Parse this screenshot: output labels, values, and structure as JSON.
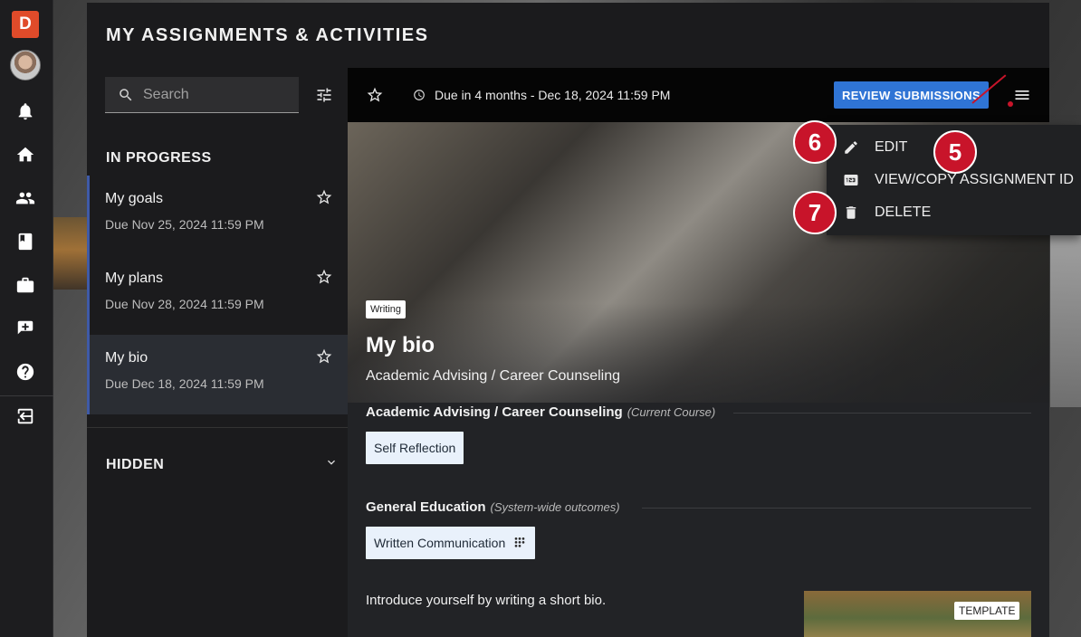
{
  "app": {
    "logo_letter": "D"
  },
  "panel": {
    "title": "MY ASSIGNMENTS & ACTIVITIES"
  },
  "search": {
    "placeholder": "Search"
  },
  "sections": {
    "in_progress": "IN PROGRESS",
    "hidden": "HIDDEN"
  },
  "assignments": [
    {
      "name": "My goals",
      "due": "Due Nov 25, 2024 11:59 PM"
    },
    {
      "name": "My plans",
      "due": "Due Nov 28, 2024 11:59 PM"
    },
    {
      "name": "My bio",
      "due": "Due Dec 18, 2024 11:59 PM",
      "active": true
    }
  ],
  "detail": {
    "due_text": "Due in 4 months - Dec 18, 2024 11:59 PM",
    "review_button": "REVIEW SUBMISSIONS",
    "tag": "Writing",
    "title": "My bio",
    "subtitle": "Academic Advising / Career Counseling",
    "groups": [
      {
        "heading": "Academic Advising / Career Counseling",
        "note": "(Current Course)",
        "chip": "Self Reflection"
      },
      {
        "heading": "General Education",
        "note": "(System-wide outcomes)",
        "chip": "Written Communication"
      }
    ],
    "intro": "Introduce yourself by writing a short bio.",
    "template_badge": "TEMPLATE"
  },
  "menu": {
    "items": [
      {
        "label": "EDIT",
        "icon": "pencil-icon"
      },
      {
        "label": "VIEW/COPY ASSIGNMENT ID",
        "icon": "number-123-icon"
      },
      {
        "label": "DELETE",
        "icon": "trash-icon"
      }
    ]
  },
  "callouts": {
    "menu": "5",
    "edit": "6",
    "delete": "7"
  },
  "colors": {
    "accent": "#2f74d5",
    "callout": "#c8142a",
    "brand": "#e04b2a",
    "active_border": "#3e5aa8"
  }
}
